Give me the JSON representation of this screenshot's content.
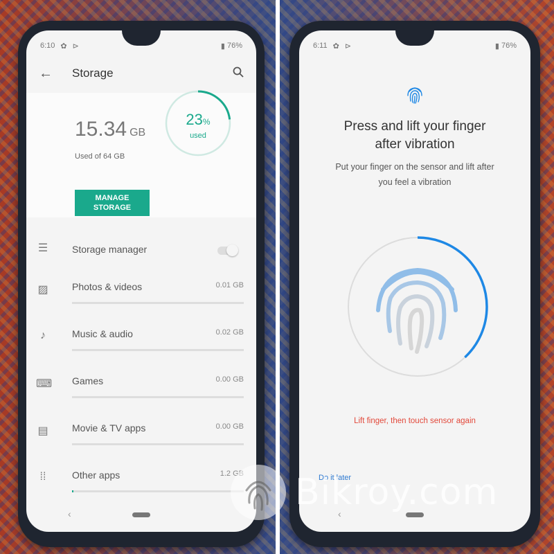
{
  "left_phone": {
    "status_time": "6:10",
    "battery": "76%",
    "title": "Storage",
    "used_value": "15.34",
    "used_unit": "GB",
    "used_of": "Used of 64 GB",
    "manage_label": "MANAGE STORAGE",
    "percent_value": "23",
    "percent_sign": "%",
    "percent_label": "used",
    "percent_used": 0.23,
    "storage_manager": {
      "label": "Storage manager",
      "enabled": false
    },
    "items": [
      {
        "label": "Photos & videos",
        "size": "0.01 GB",
        "icon": "photo-icon",
        "fill": 0.0
      },
      {
        "label": "Music & audio",
        "size": "0.02 GB",
        "icon": "music-note-icon",
        "fill": 0.0
      },
      {
        "label": "Games",
        "size": "0.00 GB",
        "icon": "gamepad-icon",
        "fill": 0.0
      },
      {
        "label": "Movie & TV apps",
        "size": "0.00 GB",
        "icon": "movie-icon",
        "fill": 0.0
      },
      {
        "label": "Other apps",
        "size": "1.2 GB",
        "icon": "apps-grid-icon",
        "fill": 0.01
      }
    ],
    "accent": "#1aa98c"
  },
  "right_phone": {
    "status_time": "6:11",
    "battery": "76%",
    "heading_line1": "Press and lift your finger",
    "heading_line2": "after vibration",
    "sub_line1": "Put your finger on the sensor and lift after",
    "sub_line2": "you feel a vibration",
    "progress": 0.38,
    "error": "Lift finger, then touch sensor again",
    "do_it_later": "Do it later",
    "accent": "#1e88e5",
    "error_color": "#e2483a"
  },
  "watermark": "Bikroy.com"
}
